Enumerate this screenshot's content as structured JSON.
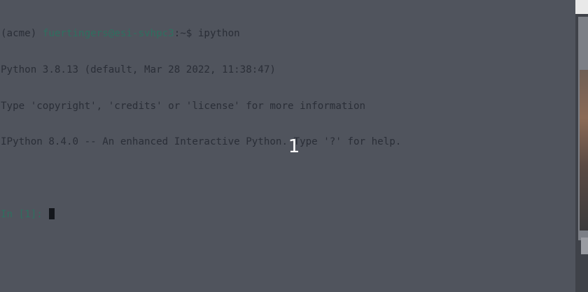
{
  "terminal": {
    "prompt_env": "(acme)",
    "prompt_user_host": "fuertingers@esi-svhpc3",
    "prompt_suffix": ":~$",
    "command": "ipython",
    "output_lines": [
      "Python 3.8.13 (default, Mar 28 2022, 11:38:47)",
      "Type 'copyright', 'credits' or 'license' for more information",
      "IPython 8.4.0 -- An enhanced Interactive Python. Type '?' for help."
    ],
    "ipython_prompt": "In [1]:"
  },
  "overlay": {
    "slide_number": "1"
  },
  "colors": {
    "background": "#50545d",
    "text": "#2a2e37",
    "prompt_green": "#2e6f5f",
    "slide_number": "#ffffff"
  }
}
